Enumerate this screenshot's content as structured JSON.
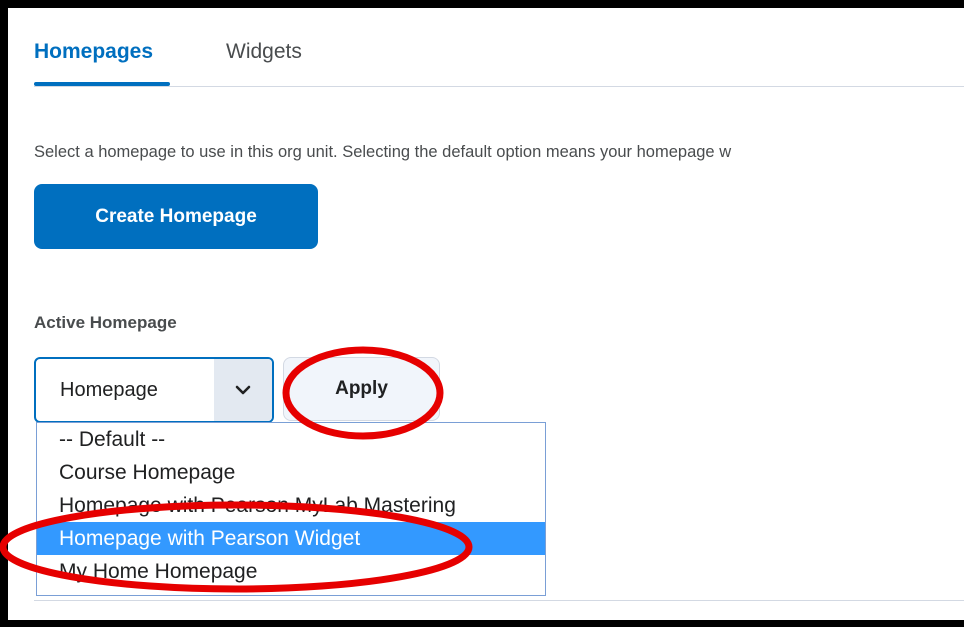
{
  "tabs": [
    {
      "label": "Homepages",
      "active": true
    },
    {
      "label": "Widgets",
      "active": false
    }
  ],
  "description": "Select a homepage to use in this org unit. Selecting the default option means your homepage w",
  "create_button": {
    "label": "Create Homepage"
  },
  "active_homepage": {
    "label": "Active Homepage",
    "select_value": "Homepage",
    "apply_label": "Apply"
  },
  "dropdown": {
    "options": [
      "-- Default --",
      "Course Homepage",
      "Homepage with Pearson MyLab Mastering",
      "Homepage with Pearson Widget",
      "My Home Homepage"
    ],
    "selected": "Homepage with Pearson Widget"
  },
  "colors": {
    "accent": "#006fbf",
    "highlight": "#3399ff",
    "annotation": "#e60000"
  },
  "icons": {
    "select_chevron": "chevron-down-icon"
  }
}
